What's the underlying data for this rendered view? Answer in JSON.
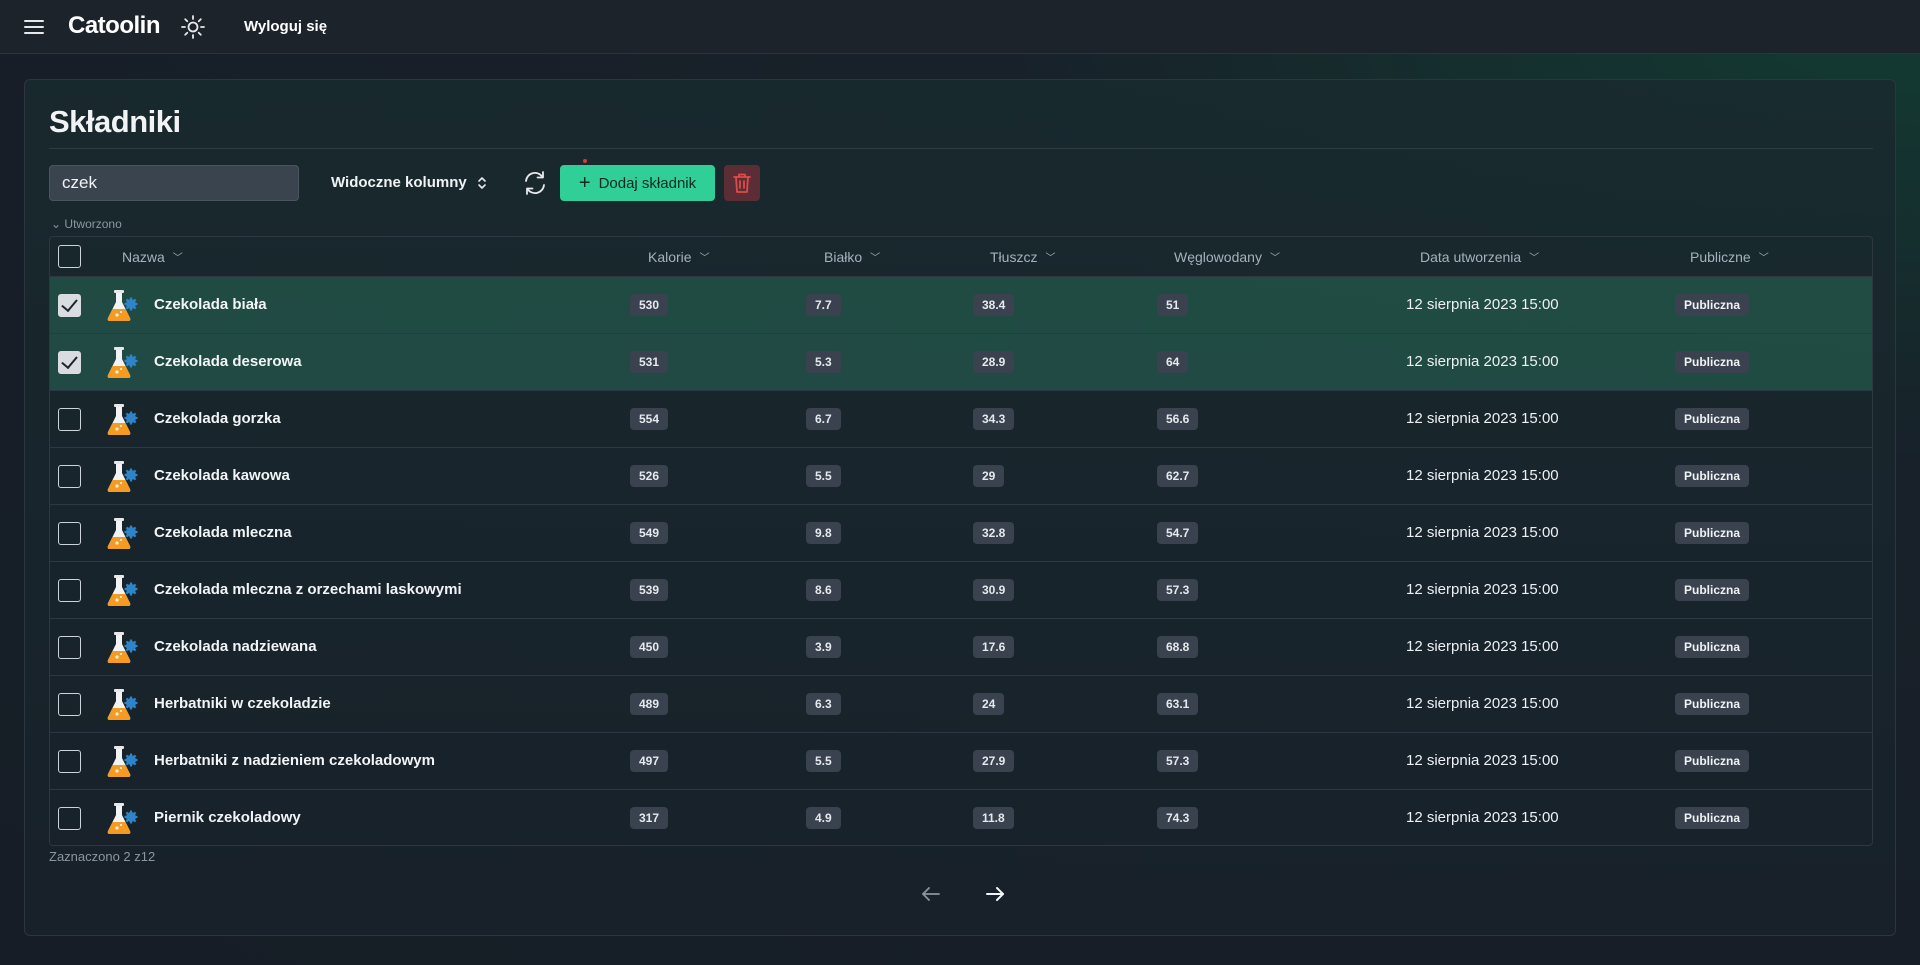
{
  "app": {
    "title": "Catoolin",
    "logout_label": "Wyloguj się"
  },
  "page": {
    "title": "Składniki"
  },
  "toolbar": {
    "search_value": "czek",
    "visible_columns_label": "Widoczne kolumny",
    "add_label": "Dodaj składnik"
  },
  "sort_note": "Utworzono",
  "columns": {
    "name": "Nazwa",
    "calories": "Kalorie",
    "protein": "Białko",
    "fat": "Tłuszcz",
    "carbs": "Węglowodany",
    "created": "Data utworzenia",
    "public": "Publiczne"
  },
  "rows": [
    {
      "name": "Czekolada biała",
      "calories": "530",
      "protein": "7.7",
      "fat": "38.4",
      "carbs": "51",
      "created": "12 sierpnia 2023 15:00",
      "public": "Publiczna",
      "selected": true
    },
    {
      "name": "Czekolada deserowa",
      "calories": "531",
      "protein": "5.3",
      "fat": "28.9",
      "carbs": "64",
      "created": "12 sierpnia 2023 15:00",
      "public": "Publiczna",
      "selected": true
    },
    {
      "name": "Czekolada gorzka",
      "calories": "554",
      "protein": "6.7",
      "fat": "34.3",
      "carbs": "56.6",
      "created": "12 sierpnia 2023 15:00",
      "public": "Publiczna",
      "selected": false
    },
    {
      "name": "Czekolada kawowa",
      "calories": "526",
      "protein": "5.5",
      "fat": "29",
      "carbs": "62.7",
      "created": "12 sierpnia 2023 15:00",
      "public": "Publiczna",
      "selected": false
    },
    {
      "name": "Czekolada mleczna",
      "calories": "549",
      "protein": "9.8",
      "fat": "32.8",
      "carbs": "54.7",
      "created": "12 sierpnia 2023 15:00",
      "public": "Publiczna",
      "selected": false
    },
    {
      "name": "Czekolada mleczna z orzechami laskowymi",
      "calories": "539",
      "protein": "8.6",
      "fat": "30.9",
      "carbs": "57.3",
      "created": "12 sierpnia 2023 15:00",
      "public": "Publiczna",
      "selected": false
    },
    {
      "name": "Czekolada nadziewana",
      "calories": "450",
      "protein": "3.9",
      "fat": "17.6",
      "carbs": "68.8",
      "created": "12 sierpnia 2023 15:00",
      "public": "Publiczna",
      "selected": false
    },
    {
      "name": "Herbatniki w czekoladzie",
      "calories": "489",
      "protein": "6.3",
      "fat": "24",
      "carbs": "63.1",
      "created": "12 sierpnia 2023 15:00",
      "public": "Publiczna",
      "selected": false
    },
    {
      "name": "Herbatniki z nadzieniem czekoladowym",
      "calories": "497",
      "protein": "5.5",
      "fat": "27.9",
      "carbs": "57.3",
      "created": "12 sierpnia 2023 15:00",
      "public": "Publiczna",
      "selected": false
    },
    {
      "name": "Piernik czekoladowy",
      "calories": "317",
      "protein": "4.9",
      "fat": "11.8",
      "carbs": "74.3",
      "created": "12 sierpnia 2023 15:00",
      "public": "Publiczna",
      "selected": false
    }
  ],
  "footer": {
    "selection_text": "Zaznaczono 2 z12"
  },
  "icons": {
    "menu": "menu-icon",
    "theme": "sun-icon",
    "sort": "chevron-updown-icon",
    "refresh": "refresh-icon",
    "add": "plus-icon",
    "delete": "trash-icon",
    "row": "flask-gear-icon",
    "prev": "arrow-left-icon",
    "next": "arrow-right-icon"
  },
  "colors": {
    "accent": "#2fcf97",
    "danger": "#e04a4a",
    "selected_row": "#2b7860"
  }
}
